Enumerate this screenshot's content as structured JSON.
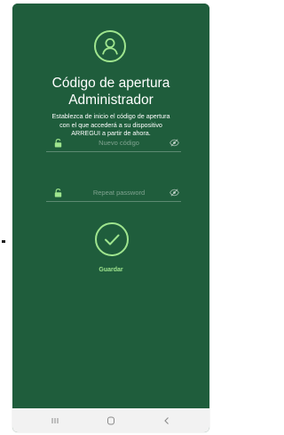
{
  "colors": {
    "background": "#1f5d3c",
    "accent": "#9fe58e",
    "text": "#ffffff",
    "nav_bar": "#f2f2f2",
    "nav_icon": "#8a8a8a"
  },
  "header": {
    "icon": "user-circle-icon",
    "title_line1": "Código de apertura",
    "title_line2": "Administrador",
    "description": [
      "Establezca de inicio el código de apertura",
      "con el que accederá a su dispositivo",
      "ARREGUI a partir de ahora."
    ]
  },
  "form": {
    "new_code": {
      "placeholder": "Nuevo código",
      "value": "",
      "lock_icon": "lock-icon",
      "toggle_icon": "eye-hidden-icon"
    },
    "repeat_password": {
      "placeholder": "Repeat password",
      "value": "",
      "lock_icon": "lock-icon",
      "toggle_icon": "eye-hidden-icon"
    }
  },
  "actions": {
    "confirm_icon": "check-circle-icon",
    "save_label": "Guardar"
  },
  "navbar": {
    "recent_icon": "recent-apps-icon",
    "home_icon": "home-icon",
    "back_icon": "back-icon"
  }
}
